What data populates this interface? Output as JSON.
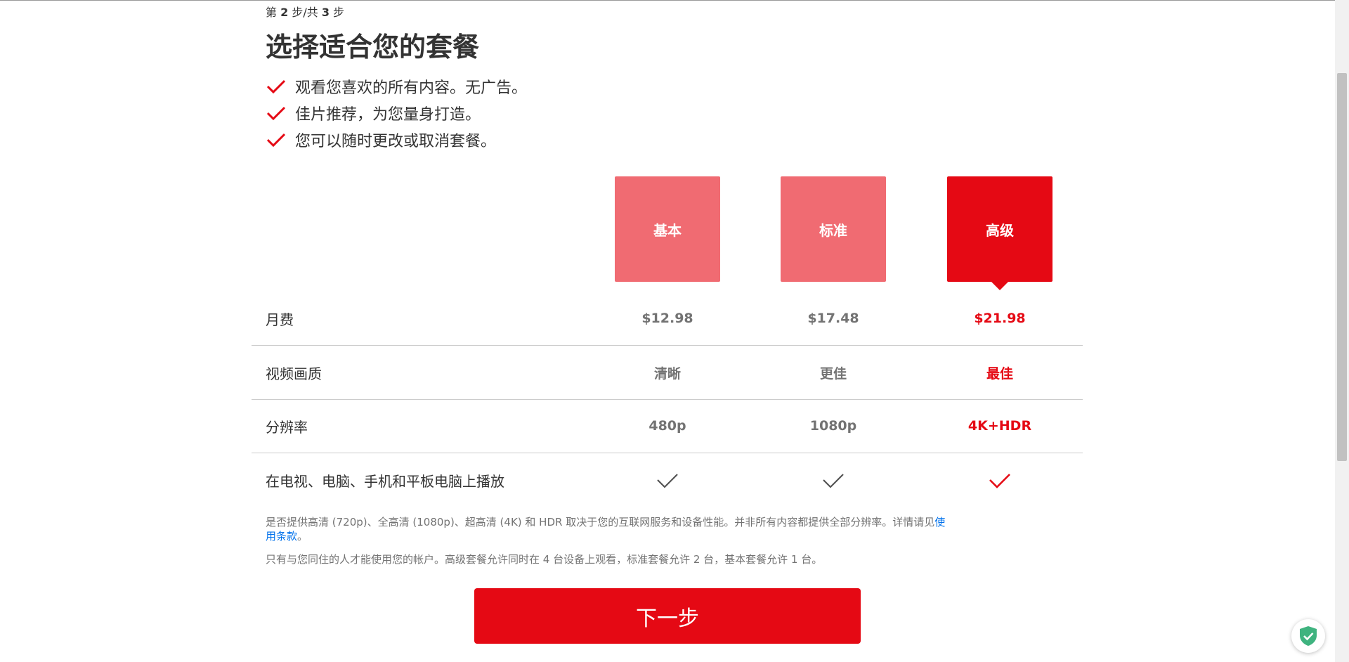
{
  "step": {
    "prefix": "第 ",
    "current": "2",
    "middle": " 步/共 ",
    "total": "3",
    "suffix": " 步"
  },
  "title": "选择适合您的套餐",
  "benefits": [
    "观看您喜欢的所有内容。无广告。",
    "佳片推荐，为您量身打造。",
    "您可以随时更改或取消套餐。"
  ],
  "plans": [
    {
      "name": "基本",
      "selected": false
    },
    {
      "name": "标准",
      "selected": false
    },
    {
      "name": "高级",
      "selected": true
    }
  ],
  "rows": [
    {
      "label": "月费",
      "values": [
        "$12.98",
        "$17.48",
        "$21.98"
      ]
    },
    {
      "label": "视频画质",
      "values": [
        "清晰",
        "更佳",
        "最佳"
      ]
    },
    {
      "label": "分辨率",
      "values": [
        "480p",
        "1080p",
        "4K+HDR"
      ]
    },
    {
      "label": "在电视、电脑、手机和平板电脑上播放",
      "values": [
        "check-icon",
        "check-icon",
        "check-icon"
      ]
    }
  ],
  "notes": {
    "quality_text": "是否提供高清 (720p)、全高清 (1080p)、超高清 (4K) 和 HDR 取决于您的互联网服务和设备性能。并非所有内容都提供全部分辨率。详情请见",
    "terms_link": "使用条款",
    "quality_end": "。",
    "household_text": "只有与您同住的人才能使用您的帐户。高级套餐允许同时在 4 台设备上观看，标准套餐允许 2 台，基本套餐允许 1 台。"
  },
  "next_button": "下一步",
  "colors": {
    "brand_red": "#e50914",
    "unselected_plan": "#f06b72",
    "muted_text": "#737373",
    "link": "#0071eb"
  }
}
